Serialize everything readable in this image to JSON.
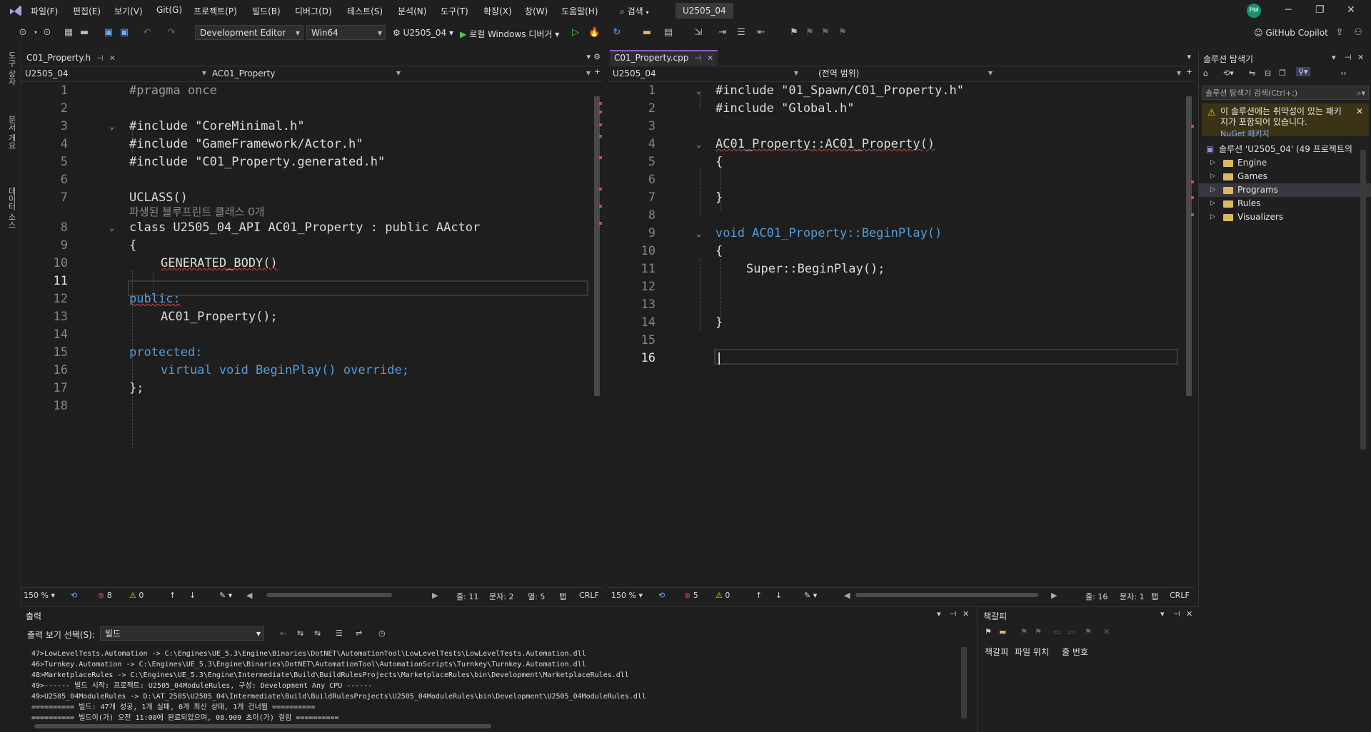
{
  "menubar": {
    "items": [
      "파일(F)",
      "편집(E)",
      "보기(V)",
      "Git(G)",
      "프로젝트(P)",
      "빌드(B)",
      "디버그(D)",
      "테스트(S)",
      "분석(N)",
      "도구(T)",
      "확장(X)",
      "창(W)",
      "도움말(H)"
    ],
    "search_label": "검색",
    "solution_name": "U2505_04",
    "avatar_initials": "PM"
  },
  "toolbar": {
    "config": "Development Editor",
    "platform": "Win64",
    "startup_project": "U2505_04",
    "debug_label": "로컬 Windows 디버거",
    "copilot_label": "GitHub Copilot"
  },
  "left_strip": {
    "tabs": [
      "도구 상자",
      "문서 개요",
      "데이터 소스"
    ]
  },
  "left_editor": {
    "tab_title": "C01_Property.h",
    "nav_project": "U2505_04",
    "nav_scope": "AC01_Property",
    "current_line": 11,
    "lines": [
      {
        "n": "1",
        "text": "#pragma once"
      },
      {
        "n": "2",
        "text": ""
      },
      {
        "n": "3",
        "text": "#include \"CoreMinimal.h\""
      },
      {
        "n": "4",
        "text": "#include \"GameFramework/Actor.h\""
      },
      {
        "n": "5",
        "text": "#include \"C01_Property.generated.h\""
      },
      {
        "n": "6",
        "text": ""
      },
      {
        "n": "7",
        "text": "UCLASS()"
      },
      {
        "n": "8",
        "text": "class U2505_04_API AC01_Property : public AActor"
      },
      {
        "n": "9",
        "text": "{"
      },
      {
        "n": "10",
        "text": "GENERATED_BODY()"
      },
      {
        "n": "11",
        "text": ""
      },
      {
        "n": "12",
        "text": "public:"
      },
      {
        "n": "13",
        "text": "AC01_Property();"
      },
      {
        "n": "14",
        "text": ""
      },
      {
        "n": "15",
        "text": "protected:"
      },
      {
        "n": "16",
        "text": "virtual void BeginPlay() override;"
      },
      {
        "n": "17",
        "text": "};"
      },
      {
        "n": "18",
        "text": ""
      }
    ],
    "hint": "파생된 블루프린트 클래스 0개",
    "status": {
      "zoom": "150 %",
      "errors": "8",
      "warnings": "0",
      "line": "줄: 11",
      "char": "문자: 2",
      "col": "열: 5",
      "tab": "탭",
      "eol": "CRLF"
    }
  },
  "right_editor": {
    "tab_title": "C01_Property.cpp",
    "nav_project": "U2505_04",
    "nav_scope": "(전역 범위)",
    "current_line": 16,
    "lines": [
      {
        "n": "1",
        "text": "#include \"01_Spawn/C01_Property.h\""
      },
      {
        "n": "2",
        "text": "#include \"Global.h\""
      },
      {
        "n": "3",
        "text": ""
      },
      {
        "n": "4",
        "text": "AC01_Property::AC01_Property()"
      },
      {
        "n": "5",
        "text": "{"
      },
      {
        "n": "6",
        "text": ""
      },
      {
        "n": "7",
        "text": "}"
      },
      {
        "n": "8",
        "text": ""
      },
      {
        "n": "9",
        "text": "void AC01_Property::BeginPlay()"
      },
      {
        "n": "10",
        "text": "{"
      },
      {
        "n": "11",
        "text": "Super::BeginPlay();"
      },
      {
        "n": "12",
        "text": ""
      },
      {
        "n": "13",
        "text": ""
      },
      {
        "n": "14",
        "text": "}"
      },
      {
        "n": "15",
        "text": ""
      },
      {
        "n": "16",
        "text": ""
      }
    ],
    "status": {
      "zoom": "150 %",
      "errors": "5",
      "warnings": "0",
      "line": "줄: 16",
      "char": "문자: 1",
      "tab": "탭",
      "eol": "CRLF"
    }
  },
  "solution_explorer": {
    "title": "솔루션 탐색기",
    "search_placeholder": "솔루션 탐색기 검색(Ctrl+;)",
    "warning_text": "이 솔루션에는 취약성이 있는 패키지가 포함되어 있습니다.",
    "warning_link": "NuGet 패키지",
    "solution_label": "솔루션 'U2505_04' (49 프로젝트의",
    "folders": [
      "Engine",
      "Games",
      "Programs",
      "Rules",
      "Visualizers"
    ],
    "selected": "Programs"
  },
  "output": {
    "title": "출력",
    "show_label": "출력 보기 선택(S):",
    "selected_source": "빌드",
    "lines": [
      "47>LowLevelTests.Automation -> C:\\Engines\\UE_5.3\\Engine\\Binaries\\DotNET\\AutomationTool\\LowLevelTests\\LowLevelTests.Automation.dll",
      "46>Turnkey.Automation -> C:\\Engines\\UE_5.3\\Engine\\Binaries\\DotNET\\AutomationTool\\AutomationScripts\\Turnkey\\Turnkey.Automation.dll",
      "48>MarketplaceRules -> C:\\Engines\\UE_5.3\\Engine\\Intermediate\\Build\\BuildRulesProjects\\MarketplaceRules\\bin\\Development\\MarketplaceRules.dll",
      "49>------ 빌드 시작: 프로젝트: U2505_04ModuleRules, 구성: Development Any CPU ------",
      "49>U2505_04ModuleRules -> D:\\AT_2505\\U2505_04\\Intermediate\\Build\\BuildRulesProjects\\U2505_04ModuleRules\\bin\\Development\\U2505_04ModuleRules.dll",
      "========== 빌드: 47개 성공, 1개 실패, 0개 최신 상태, 1개 건너뜀 ==========",
      "========== 빌드이(가) 오전 11:00에 완료되었으며, 08.909 초이(가) 걸림 =========="
    ]
  },
  "bookmarks": {
    "title": "책갈피",
    "columns": [
      "책갈피",
      "파일 위치",
      "줄 번호"
    ]
  },
  "colors": {
    "accent": "#8661c5",
    "keyword": "#569cd6",
    "string": "#d69d85",
    "error_squiggle": "#e04040",
    "avatar": "#1a8f6f"
  }
}
